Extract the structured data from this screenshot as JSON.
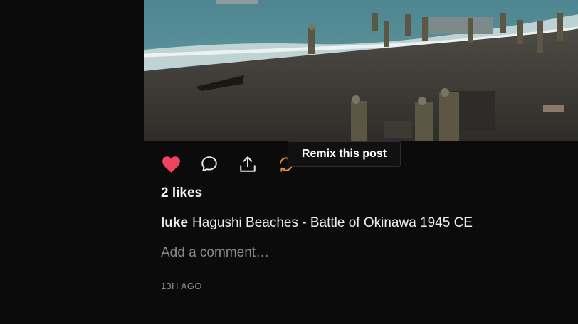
{
  "post": {
    "image_alt": "Soldiers landing on a beach",
    "likes_text": "2 likes",
    "username": "luke",
    "caption": "Hagushi Beaches - Battle of Okinawa 1945 CE",
    "comment_placeholder": "Add a comment…",
    "timestamp": "13H AGO"
  },
  "actions": {
    "like_icon": "heart-icon",
    "comment_icon": "comment-icon",
    "share_icon": "share-icon",
    "remix_icon": "remix-icon"
  },
  "tooltip": {
    "text": "Remix this post"
  },
  "colors": {
    "like": "#f0445e",
    "remix": "#e8892a",
    "background": "#0b0b0b"
  }
}
